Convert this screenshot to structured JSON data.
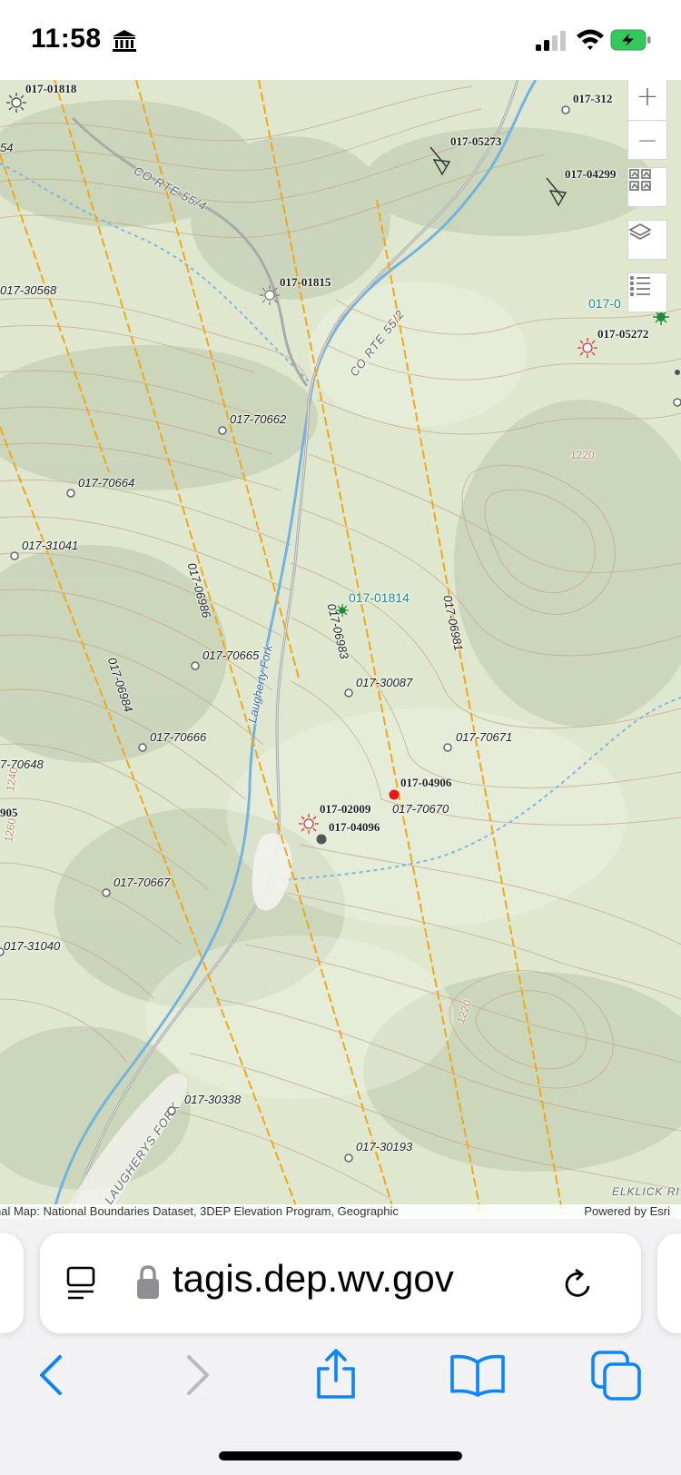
{
  "status_bar": {
    "time": "11:58",
    "icons": [
      "bank-icon",
      "cellular-signal-icon",
      "wifi-icon",
      "battery-charging-icon"
    ],
    "battery_color": "#34c759"
  },
  "map": {
    "contour_color": "#c8a68a",
    "stream_color": "#74b3e0",
    "grid_line_color": "#f0a818",
    "road_labels": [
      "CO RTE 55/4",
      "CO RTE 55/2",
      "LAUGHERYS FORK",
      "ELKLICK RI"
    ],
    "stream_labels": [
      "Laugherty Fork"
    ],
    "elevation_labels": [
      "1220",
      "1220",
      "1240",
      "1260"
    ],
    "well_labels": [
      "017-01818",
      "017-312",
      "017-05273",
      "017-04299",
      "54",
      "017-30568",
      "017-01815",
      "017-05272",
      "017-70662",
      "017-70664",
      "017-31041",
      "017-70665",
      "017-30087",
      "017-70671",
      "017-70666",
      "7-70648",
      "017-04906",
      "017-02009",
      "017-70670",
      "017-04096",
      "905",
      "017-70667",
      "017-31040",
      "017-30338",
      "017-30193"
    ],
    "teal_labels": [
      "017-01814",
      "017-0"
    ],
    "grid_labels": [
      "017-06986",
      "017-06984",
      "017-06983",
      "017-06981"
    ]
  },
  "map_controls": {
    "zoom_in": "+",
    "zoom_out": "−",
    "icons": [
      "zoom-in-icon",
      "zoom-out-icon",
      "basemap-gallery-icon",
      "layers-icon",
      "legend-list-icon"
    ]
  },
  "attribution": {
    "sources": "nal Map: National Boundaries Dataset, 3DEP Elevation Program, Geographic",
    "powered_by": "Powered by Esri"
  },
  "browser": {
    "url": "tagis.dep.wv.gov",
    "url_fade": "t",
    "icons": [
      "reader-mode-icon",
      "lock-icon",
      "reload-icon",
      "back-icon",
      "forward-icon",
      "share-icon",
      "bookmarks-icon",
      "tabs-icon"
    ],
    "accent_color": "#0a84ff"
  }
}
